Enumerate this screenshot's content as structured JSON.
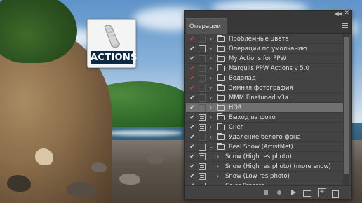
{
  "actions_icon": {
    "label": "ACTIONS"
  },
  "panel": {
    "title": "Операции",
    "collapse_glyph": "◀◀",
    "close_glyph": "✕"
  },
  "rows": [
    {
      "label": "Проблемные цвета",
      "check": "red",
      "dialog": "empty",
      "expand": "›",
      "type": "folder",
      "selected": false
    },
    {
      "label": "Операции по умолчанию",
      "check": "white",
      "dialog": "on",
      "expand": "›",
      "type": "folder",
      "selected": false
    },
    {
      "label": "My Actions for PPW",
      "check": "white",
      "dialog": "empty",
      "expand": "›",
      "type": "folder",
      "selected": false
    },
    {
      "label": "Margulis PPW Actions v 5.0",
      "check": "red",
      "dialog": "empty",
      "expand": "›",
      "type": "folder",
      "selected": false
    },
    {
      "label": "Водопад",
      "check": "red",
      "dialog": "empty",
      "expand": "›",
      "type": "folder",
      "selected": false
    },
    {
      "label": "Зимняя фотография",
      "check": "red",
      "dialog": "empty",
      "expand": "›",
      "type": "folder",
      "selected": false
    },
    {
      "label": "MMM Finetuned v3a",
      "check": "white",
      "dialog": "empty",
      "expand": "›",
      "type": "folder",
      "selected": false
    },
    {
      "label": "HDR",
      "check": "white",
      "dialog": "empty",
      "expand": "›",
      "type": "folder",
      "selected": true
    },
    {
      "label": "Выход из фото",
      "check": "white",
      "dialog": "on",
      "expand": "›",
      "type": "folder",
      "selected": false
    },
    {
      "label": "Снег",
      "check": "white",
      "dialog": "on",
      "expand": "›",
      "type": "folder",
      "selected": false
    },
    {
      "label": "Удаление белого фона",
      "check": "white",
      "dialog": "empty",
      "expand": "›",
      "type": "folder",
      "selected": false
    },
    {
      "label": "Real Snow (ArtistMef)",
      "check": "white",
      "dialog": "on",
      "expand": "⌄",
      "type": "folder",
      "selected": false
    },
    {
      "label": "Snow (High res photo)",
      "check": "white",
      "dialog": "on",
      "expand": "›",
      "type": "action",
      "selected": false
    },
    {
      "label": "Snow (High res photo) (more snow)",
      "check": "white",
      "dialog": "on",
      "expand": "›",
      "type": "action",
      "selected": false
    },
    {
      "label": "Snow (Low res photo)",
      "check": "white",
      "dialog": "on",
      "expand": "›",
      "type": "action",
      "selected": false
    },
    {
      "label": "Color Presets",
      "check": "white",
      "dialog": "on",
      "expand": "›",
      "type": "action",
      "selected": false
    }
  ],
  "footer_buttons": [
    "stop-recording",
    "begin-recording",
    "play-selection",
    "create-new-set",
    "create-new-action",
    "delete"
  ]
}
